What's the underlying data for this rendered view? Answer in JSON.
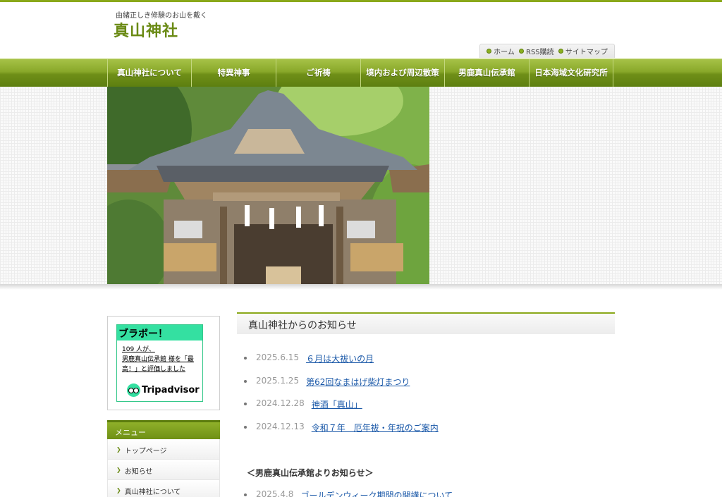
{
  "header": {
    "tagline": "由緒正しき修験のお山を戴く",
    "site_title": "真山神社"
  },
  "util_links": [
    "ホーム",
    "RSS購読",
    "サイトマップ"
  ],
  "nav": [
    {
      "label": "真山神社について"
    },
    {
      "label": "特異神事"
    },
    {
      "label": "ご祈祷"
    },
    {
      "label": "境内および周辺散策"
    },
    {
      "label": "男鹿真山伝承館"
    },
    {
      "label": "日本海域文化研究所"
    }
  ],
  "tripadvisor": {
    "headline": "ブラボー！",
    "count_text": "109 人が、",
    "place_name": "男鹿真山伝承館 様",
    "rating_text": "を「最高！」と評価しました",
    "brand": "Tripadvisor"
  },
  "menu": {
    "heading": "メニュー",
    "items": [
      "トップページ",
      "お知らせ",
      "真山神社について"
    ]
  },
  "news": {
    "heading": "真山神社からのお知らせ",
    "items": [
      {
        "date": "2025.6.15",
        "title": "６月は大祓いの月"
      },
      {
        "date": "2025.1.25",
        "title": "第62回なまはげ柴灯まつり"
      },
      {
        "date": "2024.12.28",
        "title": "神酒「真山」"
      },
      {
        "date": "2024.12.13",
        "title": "令和７年　厄年祓・年祝のご案内"
      }
    ],
    "subheading": "＜男鹿真山伝承館よりお知らせ＞",
    "partial_item": {
      "date": "2025.4.8",
      "title": "ゴールデンウィーク期間の開講について"
    }
  },
  "colors": {
    "accent_green": "#8aa81a",
    "nav_green": "#6f8f18",
    "link_blue": "#1a58a8",
    "trip_green": "#34e0a1"
  }
}
